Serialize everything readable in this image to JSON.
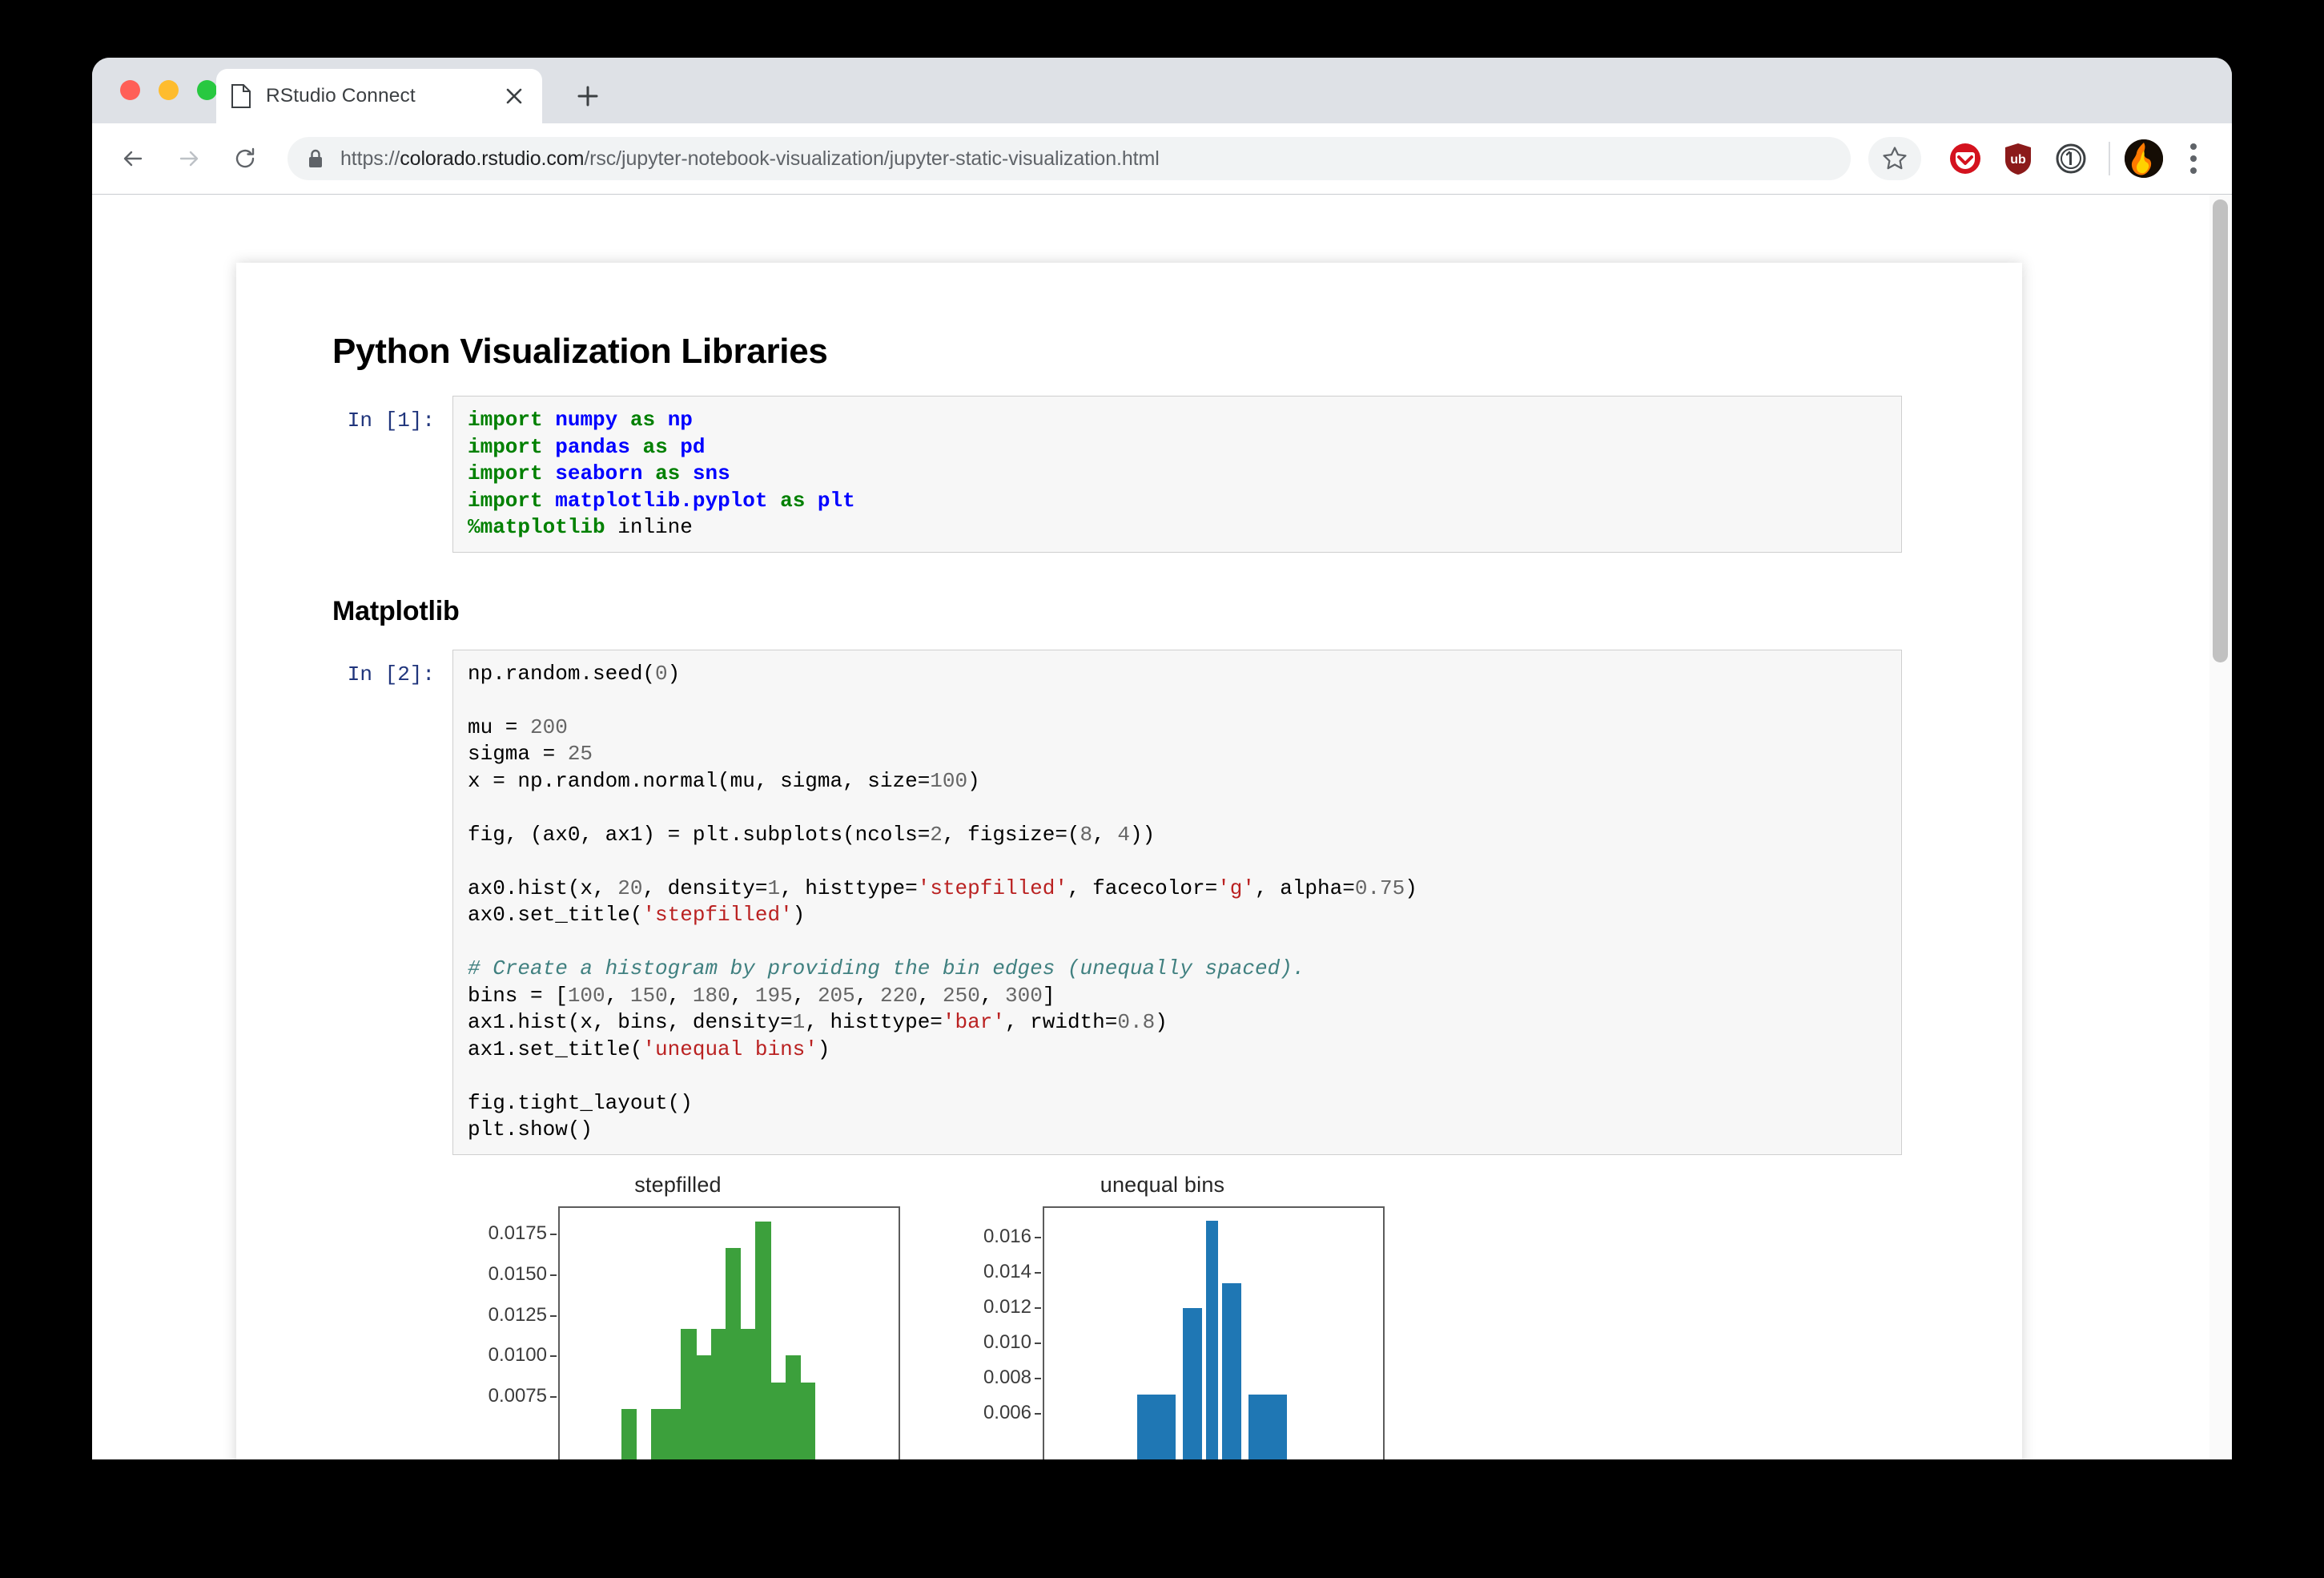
{
  "browser": {
    "traffic_lights": [
      "close",
      "minimize",
      "maximize"
    ],
    "tab": {
      "title": "RStudio Connect",
      "favicon": "page-icon",
      "close_label": "×"
    },
    "new_tab_label": "+",
    "nav": {
      "back": "←",
      "forward": "→",
      "reload": "↻"
    },
    "omnibox": {
      "lock": "lock-icon",
      "url_scheme": "https://",
      "url_host": "colorado.rstudio.com",
      "url_path": "/rsc/jupyter-notebook-visualization/jupyter-static-visualization.html"
    },
    "toolbar_icons": [
      "bookmark-star-icon",
      "pocket-extension-icon",
      "ublock-origin-icon",
      "onepassword-icon",
      "profile-avatar",
      "chrome-menu-icon"
    ]
  },
  "notebook": {
    "title": "Python Visualization Libraries",
    "section_heading": "Matplotlib",
    "cells": [
      {
        "prompt": "In [1]:",
        "lines": [
          [
            {
              "t": "import",
              "c": "k"
            },
            {
              "t": " ",
              "c": ""
            },
            {
              "t": "numpy",
              "c": "nn"
            },
            {
              "t": " ",
              "c": ""
            },
            {
              "t": "as",
              "c": "k"
            },
            {
              "t": " ",
              "c": ""
            },
            {
              "t": "np",
              "c": "nn"
            }
          ],
          [
            {
              "t": "import",
              "c": "k"
            },
            {
              "t": " ",
              "c": ""
            },
            {
              "t": "pandas",
              "c": "nn"
            },
            {
              "t": " ",
              "c": ""
            },
            {
              "t": "as",
              "c": "k"
            },
            {
              "t": " ",
              "c": ""
            },
            {
              "t": "pd",
              "c": "nn"
            }
          ],
          [
            {
              "t": "import",
              "c": "k"
            },
            {
              "t": " ",
              "c": ""
            },
            {
              "t": "seaborn",
              "c": "nn"
            },
            {
              "t": " ",
              "c": ""
            },
            {
              "t": "as",
              "c": "k"
            },
            {
              "t": " ",
              "c": ""
            },
            {
              "t": "sns",
              "c": "nn"
            }
          ],
          [
            {
              "t": "import",
              "c": "k"
            },
            {
              "t": " ",
              "c": ""
            },
            {
              "t": "matplotlib.pyplot",
              "c": "nn"
            },
            {
              "t": " ",
              "c": ""
            },
            {
              "t": "as",
              "c": "k"
            },
            {
              "t": " ",
              "c": ""
            },
            {
              "t": "plt",
              "c": "nn"
            }
          ],
          [
            {
              "t": "%matplotlib",
              "c": "nb"
            },
            {
              "t": " inline",
              "c": ""
            }
          ]
        ]
      },
      {
        "prompt": "In [2]:",
        "lines": [
          [
            {
              "t": "np.random.seed(",
              "c": ""
            },
            {
              "t": "0",
              "c": "m"
            },
            {
              "t": ")",
              "c": ""
            }
          ],
          [
            {
              "t": "",
              "c": ""
            }
          ],
          [
            {
              "t": "mu = ",
              "c": ""
            },
            {
              "t": "200",
              "c": "m"
            }
          ],
          [
            {
              "t": "sigma = ",
              "c": ""
            },
            {
              "t": "25",
              "c": "m"
            }
          ],
          [
            {
              "t": "x = np.random.normal(mu, sigma, size=",
              "c": ""
            },
            {
              "t": "100",
              "c": "m"
            },
            {
              "t": ")",
              "c": ""
            }
          ],
          [
            {
              "t": "",
              "c": ""
            }
          ],
          [
            {
              "t": "fig, (ax0, ax1) = plt.subplots(ncols=",
              "c": ""
            },
            {
              "t": "2",
              "c": "m"
            },
            {
              "t": ", figsize=(",
              "c": ""
            },
            {
              "t": "8",
              "c": "m"
            },
            {
              "t": ", ",
              "c": ""
            },
            {
              "t": "4",
              "c": "m"
            },
            {
              "t": "))",
              "c": ""
            }
          ],
          [
            {
              "t": "",
              "c": ""
            }
          ],
          [
            {
              "t": "ax0.hist(x, ",
              "c": ""
            },
            {
              "t": "20",
              "c": "m"
            },
            {
              "t": ", density=",
              "c": ""
            },
            {
              "t": "1",
              "c": "m"
            },
            {
              "t": ", histtype=",
              "c": ""
            },
            {
              "t": "'stepfilled'",
              "c": "s"
            },
            {
              "t": ", facecolor=",
              "c": ""
            },
            {
              "t": "'g'",
              "c": "s"
            },
            {
              "t": ", alpha=",
              "c": ""
            },
            {
              "t": "0.75",
              "c": "m"
            },
            {
              "t": ")",
              "c": ""
            }
          ],
          [
            {
              "t": "ax0.set_title(",
              "c": ""
            },
            {
              "t": "'stepfilled'",
              "c": "s"
            },
            {
              "t": ")",
              "c": ""
            }
          ],
          [
            {
              "t": "",
              "c": ""
            }
          ],
          [
            {
              "t": "# Create a histogram by providing the bin edges (unequally spaced).",
              "c": "c"
            }
          ],
          [
            {
              "t": "bins = [",
              "c": ""
            },
            {
              "t": "100",
              "c": "m"
            },
            {
              "t": ", ",
              "c": ""
            },
            {
              "t": "150",
              "c": "m"
            },
            {
              "t": ", ",
              "c": ""
            },
            {
              "t": "180",
              "c": "m"
            },
            {
              "t": ", ",
              "c": ""
            },
            {
              "t": "195",
              "c": "m"
            },
            {
              "t": ", ",
              "c": ""
            },
            {
              "t": "205",
              "c": "m"
            },
            {
              "t": ", ",
              "c": ""
            },
            {
              "t": "220",
              "c": "m"
            },
            {
              "t": ", ",
              "c": ""
            },
            {
              "t": "250",
              "c": "m"
            },
            {
              "t": ", ",
              "c": ""
            },
            {
              "t": "300",
              "c": "m"
            },
            {
              "t": "]",
              "c": ""
            }
          ],
          [
            {
              "t": "ax1.hist(x, bins, density=",
              "c": ""
            },
            {
              "t": "1",
              "c": "m"
            },
            {
              "t": ", histtype=",
              "c": ""
            },
            {
              "t": "'bar'",
              "c": "s"
            },
            {
              "t": ", rwidth=",
              "c": ""
            },
            {
              "t": "0.8",
              "c": "m"
            },
            {
              "t": ")",
              "c": ""
            }
          ],
          [
            {
              "t": "ax1.set_title(",
              "c": ""
            },
            {
              "t": "'unequal bins'",
              "c": "s"
            },
            {
              "t": ")",
              "c": ""
            }
          ],
          [
            {
              "t": "",
              "c": ""
            }
          ],
          [
            {
              "t": "fig.tight_layout()",
              "c": ""
            }
          ],
          [
            {
              "t": "plt.show()",
              "c": ""
            }
          ]
        ]
      }
    ]
  },
  "chart_data": [
    {
      "type": "bar",
      "title": "stepfilled",
      "xlabel": "",
      "ylabel": "",
      "color": "#3ca03c",
      "yticks": [
        0.0075,
        0.01,
        0.0125,
        0.015,
        0.0175
      ],
      "ytick_labels": [
        "0.0075",
        "0.0100",
        "0.0125",
        "0.0150",
        "0.0175"
      ],
      "ylim": [
        0.0,
        0.0192
      ],
      "grid": false,
      "bin_count": 20,
      "values": [
        0.0,
        0.0,
        0.0,
        0.00667,
        0.0,
        0.00667,
        0.00667,
        0.01167,
        0.01,
        0.01167,
        0.01667,
        0.01167,
        0.01833,
        0.00833,
        0.01,
        0.00833,
        0.0,
        0.0,
        0.0,
        0.0
      ]
    },
    {
      "type": "bar",
      "title": "unequal bins",
      "xlabel": "",
      "ylabel": "",
      "color": "#1f77b4",
      "yticks": [
        0.006,
        0.008,
        0.01,
        0.012,
        0.014,
        0.016
      ],
      "ytick_labels": [
        "0.006",
        "0.008",
        "0.010",
        "0.012",
        "0.014",
        "0.016"
      ],
      "ylim": [
        0.0,
        0.01775
      ],
      "grid": false,
      "bin_edges": [
        100,
        150,
        180,
        195,
        205,
        220,
        250,
        300
      ],
      "values": [
        0.0,
        0.007,
        0.012,
        0.017,
        0.0134,
        0.007,
        0.0
      ]
    }
  ]
}
